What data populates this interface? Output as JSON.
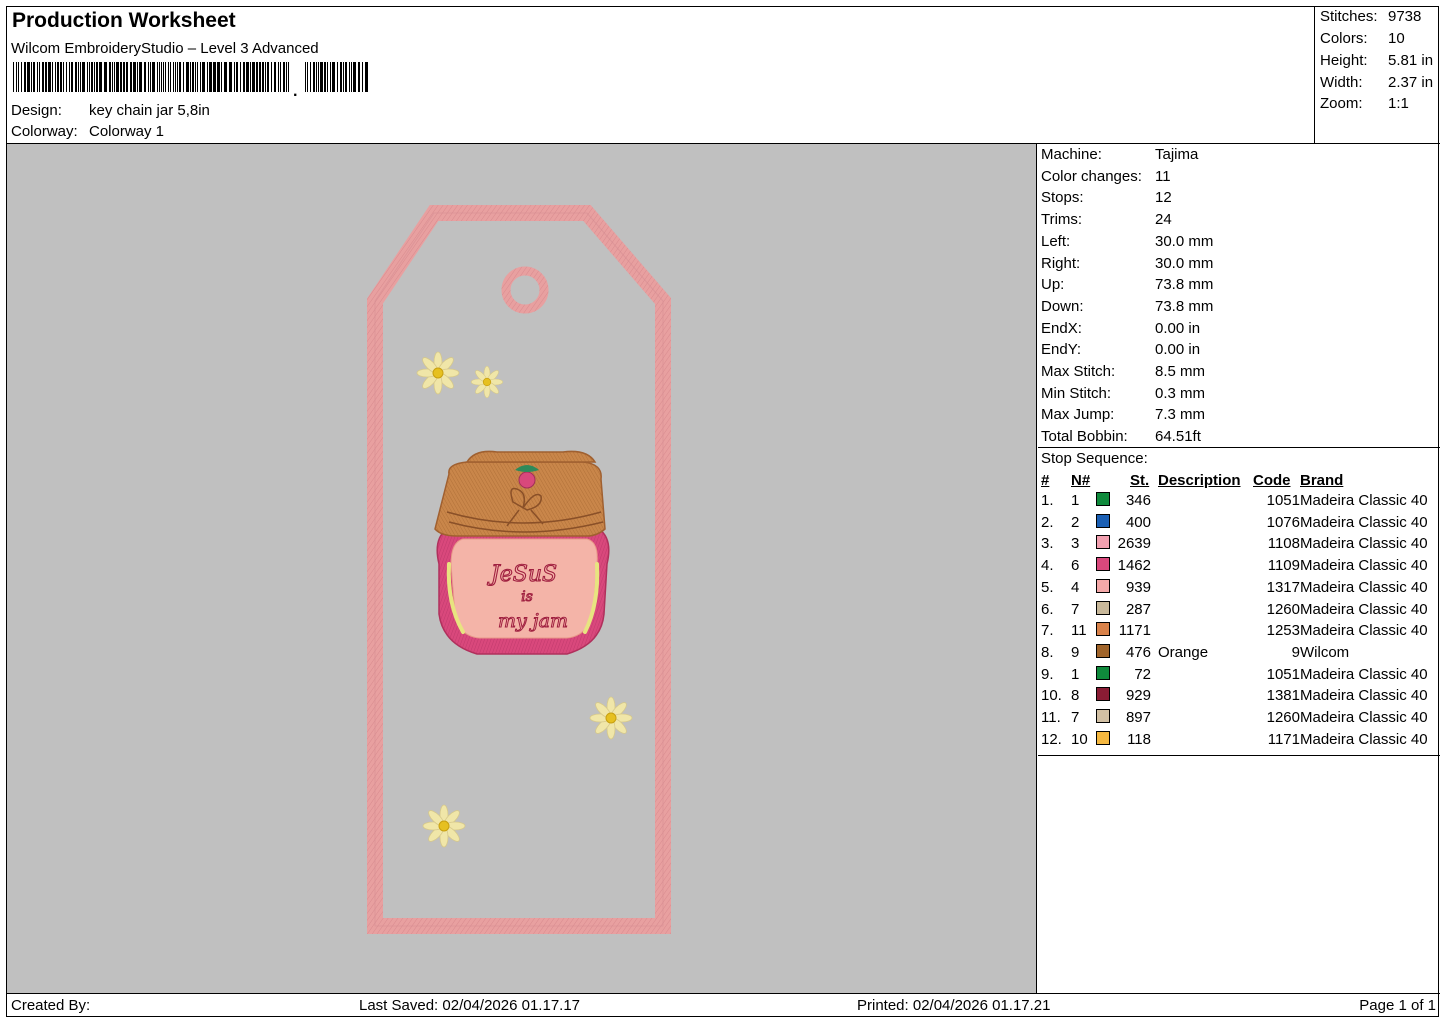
{
  "header": {
    "title": "Production Worksheet",
    "subtitle": "Wilcom EmbroideryStudio – Level 3 Advanced",
    "design_label": "Design:",
    "design_value": "key chain jar 5,8in",
    "colorway_label": "Colorway:",
    "colorway_value": "Colorway 1"
  },
  "stats": [
    {
      "label": "Stitches:",
      "value": "9738"
    },
    {
      "label": "Colors:",
      "value": "10"
    },
    {
      "label": "Height:",
      "value": "5.81 in"
    },
    {
      "label": "Width:",
      "value": "2.37 in"
    },
    {
      "label": "Zoom:",
      "value": "1:1"
    }
  ],
  "machine_info": [
    {
      "label": "Machine:",
      "value": "Tajima"
    },
    {
      "label": "Color changes:",
      "value": "11"
    },
    {
      "label": "Stops:",
      "value": "12"
    },
    {
      "label": "Trims:",
      "value": "24"
    },
    {
      "label": "Left:",
      "value": "30.0 mm"
    },
    {
      "label": "Right:",
      "value": "30.0 mm"
    },
    {
      "label": "Up:",
      "value": "73.8 mm"
    },
    {
      "label": "Down:",
      "value": "73.8 mm"
    },
    {
      "label": "EndX:",
      "value": "0.00 in"
    },
    {
      "label": "EndY:",
      "value": "0.00 in"
    },
    {
      "label": "Max Stitch:",
      "value": "8.5 mm"
    },
    {
      "label": "Min Stitch:",
      "value": "0.3 mm"
    },
    {
      "label": "Max Jump:",
      "value": "7.3 mm"
    },
    {
      "label": "Total Bobbin:",
      "value": "64.51ft"
    }
  ],
  "stop_sequence": {
    "title": "Stop Sequence:",
    "headers": {
      "idx": "#",
      "n": "N#",
      "st": "St.",
      "desc": "Description",
      "code": "Code",
      "brand": "Brand"
    },
    "rows": [
      {
        "idx": "1.",
        "n": "1",
        "color": "#0f8a3c",
        "st": "346",
        "desc": "",
        "code": "1051",
        "brand": "Madeira Classic 40"
      },
      {
        "idx": "2.",
        "n": "2",
        "color": "#1a5fb4",
        "st": "400",
        "desc": "",
        "code": "1076",
        "brand": "Madeira Classic 40"
      },
      {
        "idx": "3.",
        "n": "3",
        "color": "#f2a0b0",
        "st": "2639",
        "desc": "",
        "code": "1108",
        "brand": "Madeira Classic 40"
      },
      {
        "idx": "4.",
        "n": "6",
        "color": "#d9487c",
        "st": "1462",
        "desc": "",
        "code": "1109",
        "brand": "Madeira Classic 40"
      },
      {
        "idx": "5.",
        "n": "4",
        "color": "#f4a8a8",
        "st": "939",
        "desc": "",
        "code": "1317",
        "brand": "Madeira Classic 40"
      },
      {
        "idx": "6.",
        "n": "7",
        "color": "#c8b89a",
        "st": "287",
        "desc": "",
        "code": "1260",
        "brand": "Madeira Classic 40"
      },
      {
        "idx": "7.",
        "n": "11",
        "color": "#d9824a",
        "st": "1171",
        "desc": "",
        "code": "1253",
        "brand": "Madeira Classic 40"
      },
      {
        "idx": "8.",
        "n": "9",
        "color": "#a0642a",
        "st": "476",
        "desc": "Orange",
        "code": "9",
        "brand": "Wilcom"
      },
      {
        "idx": "9.",
        "n": "1",
        "color": "#0f8a3c",
        "st": "72",
        "desc": "",
        "code": "1051",
        "brand": "Madeira Classic 40"
      },
      {
        "idx": "10.",
        "n": "8",
        "color": "#8a1c34",
        "st": "929",
        "desc": "",
        "code": "1381",
        "brand": "Madeira Classic 40"
      },
      {
        "idx": "11.",
        "n": "7",
        "color": "#d2c0a4",
        "st": "897",
        "desc": "",
        "code": "1260",
        "brand": "Madeira Classic 40"
      },
      {
        "idx": "12.",
        "n": "10",
        "color": "#f5b840",
        "st": "118",
        "desc": "",
        "code": "1171",
        "brand": "Madeira Classic 40"
      }
    ]
  },
  "design": {
    "jar_text_line1": "JeSuS",
    "jar_text_line2": "is",
    "jar_text_line3": "my jam",
    "tag_color": "#e8a0a0",
    "lid_color": "#c9864a",
    "jar_color": "#d9487c",
    "flower_color": "#f0e6a8"
  },
  "footer": {
    "created_by": "Created By:",
    "last_saved": "Last Saved: 02/04/2026 01.17.17",
    "printed": "Printed: 02/04/2026 01.17.21",
    "page": "Page 1 of 1"
  }
}
